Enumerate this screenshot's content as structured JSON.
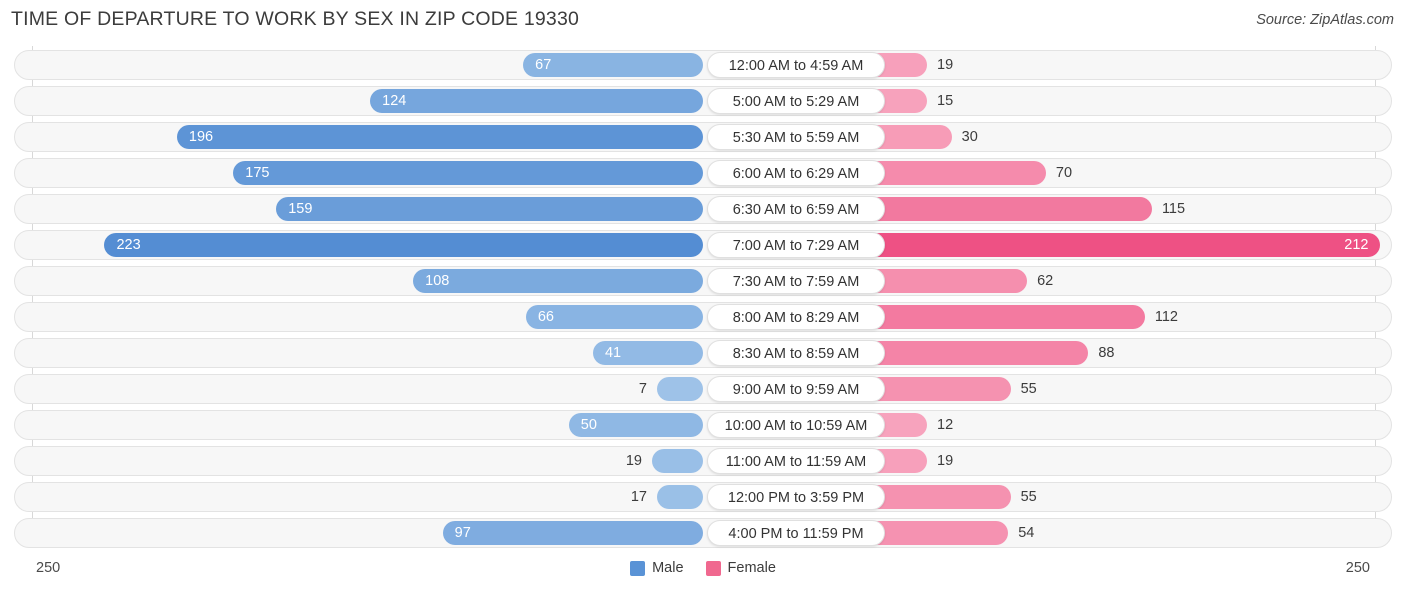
{
  "header": {
    "title": "TIME OF DEPARTURE TO WORK BY SEX IN ZIP CODE 19330",
    "source": "Source: ZipAtlas.com"
  },
  "footer": {
    "axis_max_left": "250",
    "axis_max_right": "250",
    "legend": [
      {
        "label": "Male",
        "color": "#5a93d6"
      },
      {
        "label": "Female",
        "color": "#f0688f"
      }
    ]
  },
  "chart_data": {
    "type": "bar",
    "subtype": "diverging-bar",
    "title": "TIME OF DEPARTURE TO WORK BY SEX IN ZIP CODE 19330",
    "xlabel": "",
    "ylabel": "",
    "xlim": [
      250,
      250
    ],
    "axis_note": "Diverging horizontal axis: Male extends left to 250, Female extends right to 250",
    "grid": true,
    "legend_position": "bottom-center",
    "categories": [
      "12:00 AM to 4:59 AM",
      "5:00 AM to 5:29 AM",
      "5:30 AM to 5:59 AM",
      "6:00 AM to 6:29 AM",
      "6:30 AM to 6:59 AM",
      "7:00 AM to 7:29 AM",
      "7:30 AM to 7:59 AM",
      "8:00 AM to 8:29 AM",
      "8:30 AM to 8:59 AM",
      "9:00 AM to 9:59 AM",
      "10:00 AM to 10:59 AM",
      "11:00 AM to 11:59 AM",
      "12:00 PM to 3:59 PM",
      "4:00 PM to 11:59 PM"
    ],
    "series": [
      {
        "name": "Male",
        "color": "#5a93d6",
        "values": [
          67,
          124,
          196,
          175,
          159,
          223,
          108,
          66,
          41,
          7,
          50,
          19,
          17,
          97
        ]
      },
      {
        "name": "Female",
        "color": "#f0688f",
        "values": [
          19,
          15,
          30,
          70,
          115,
          212,
          62,
          112,
          88,
          55,
          12,
          19,
          55,
          54
        ]
      }
    ]
  }
}
